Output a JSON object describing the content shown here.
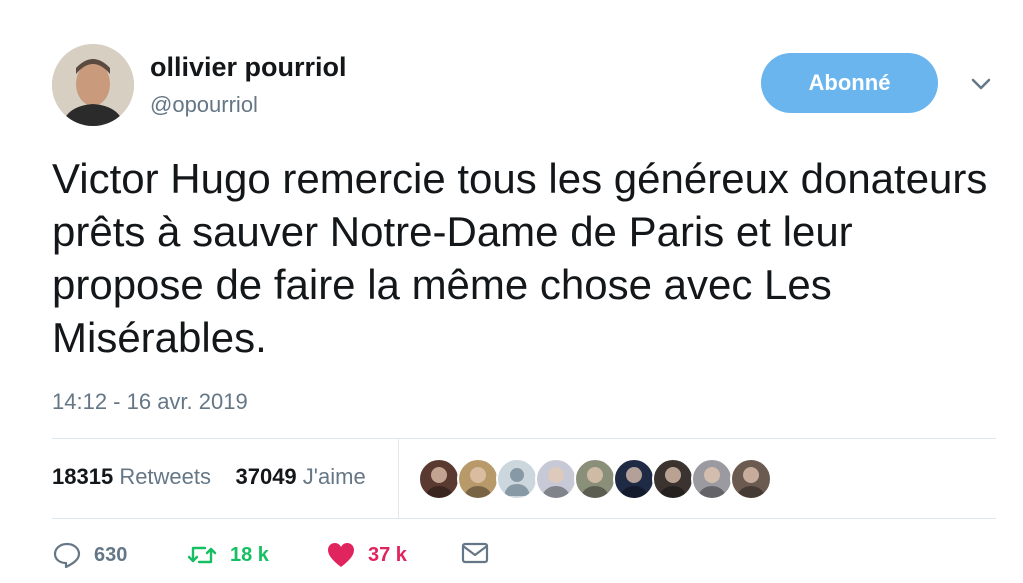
{
  "author": {
    "name": "ollivier pourriol",
    "handle": "@opourriol"
  },
  "follow_button": {
    "label": "Abonné",
    "color": "#6ab5ee"
  },
  "tweet": {
    "text": "Victor Hugo remercie tous les généreux donateurs prêts à sauver Notre-Dame de Paris et leur propose de faire la même chose avec Les Misérables.",
    "timestamp": "14:12 - 16 avr. 2019"
  },
  "stats": {
    "retweets_count": "18315",
    "retweets_label": "Retweets",
    "likes_count": "37049",
    "likes_label": "J'aime"
  },
  "likers": [
    {
      "icon": "avatar-1",
      "color": "#5a3a30"
    },
    {
      "icon": "avatar-2",
      "color": "#b89a6a"
    },
    {
      "icon": "avatar-default",
      "color": "#ccd6dd"
    },
    {
      "icon": "avatar-4",
      "color": "#c7c9d6"
    },
    {
      "icon": "avatar-5",
      "color": "#8a8f7a"
    },
    {
      "icon": "avatar-6",
      "color": "#1f2a44"
    },
    {
      "icon": "avatar-7",
      "color": "#3a3330"
    },
    {
      "icon": "avatar-8",
      "color": "#9a9aa0"
    },
    {
      "icon": "avatar-9",
      "color": "#6b5a50"
    }
  ],
  "actions": {
    "reply_count": "630",
    "retweet_count": "18 k",
    "like_count": "37 k"
  },
  "colors": {
    "accent": "#1da1f2",
    "retweet": "#17bf63",
    "like": "#e0245e",
    "muted": "#657786"
  }
}
